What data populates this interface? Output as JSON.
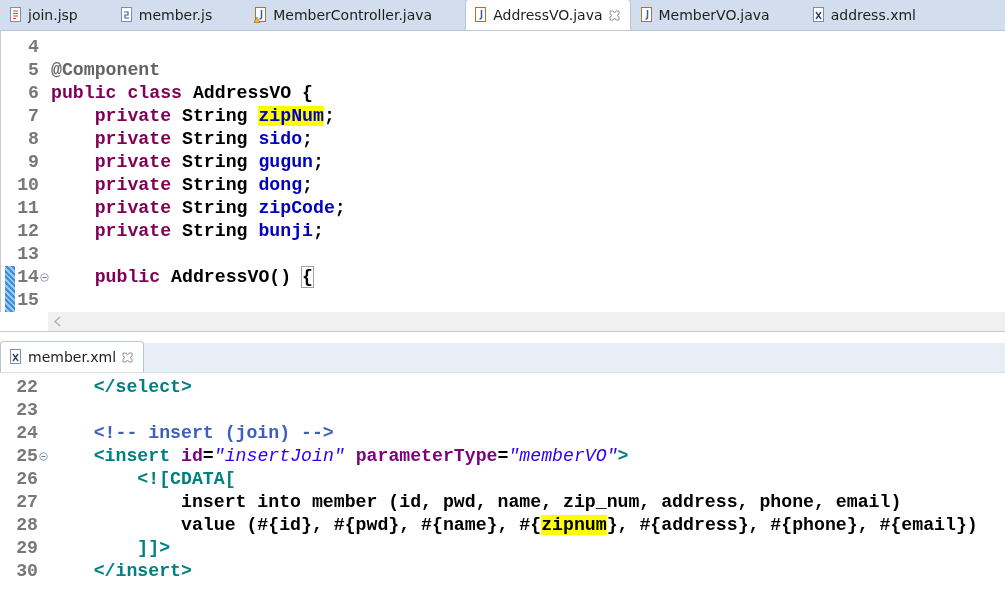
{
  "editor_tabs": [
    {
      "label": "join.jsp",
      "kind": "jsp",
      "selected": false
    },
    {
      "label": "member.js",
      "kind": "js",
      "selected": false
    },
    {
      "label": "MemberController.java",
      "kind": "java-warning",
      "selected": false
    },
    {
      "label": "AddressVO.java",
      "kind": "java",
      "selected": true
    },
    {
      "label": "MemberVO.java",
      "kind": "java",
      "selected": false
    },
    {
      "label": "address.xml",
      "kind": "xml",
      "selected": false
    }
  ],
  "top_editor": {
    "lines": [
      {
        "number": "4"
      },
      {
        "number": "5",
        "tokens": [
          {
            "text": "@Component",
            "kind": "annotation"
          }
        ]
      },
      {
        "number": "6",
        "tokens": [
          {
            "text": "public class",
            "kind": "keyword"
          },
          {
            "text": " AddressVO {",
            "kind": "plain"
          }
        ]
      },
      {
        "number": "7",
        "tokens": [
          {
            "text": "    private",
            "kind": "keyword"
          },
          {
            "text": " String ",
            "kind": "plain"
          },
          {
            "text": "zipNum",
            "kind": "field",
            "highlighted": true
          },
          {
            "text": ";",
            "kind": "plain"
          }
        ]
      },
      {
        "number": "8",
        "tokens": [
          {
            "text": "    private",
            "kind": "keyword"
          },
          {
            "text": " String ",
            "kind": "plain"
          },
          {
            "text": "sido",
            "kind": "field"
          },
          {
            "text": ";",
            "kind": "plain"
          }
        ]
      },
      {
        "number": "9",
        "tokens": [
          {
            "text": "    private",
            "kind": "keyword"
          },
          {
            "text": " String ",
            "kind": "plain"
          },
          {
            "text": "gugun",
            "kind": "field"
          },
          {
            "text": ";",
            "kind": "plain"
          }
        ]
      },
      {
        "number": "10",
        "tokens": [
          {
            "text": "    private",
            "kind": "keyword"
          },
          {
            "text": " String ",
            "kind": "plain"
          },
          {
            "text": "dong",
            "kind": "field"
          },
          {
            "text": ";",
            "kind": "plain"
          }
        ]
      },
      {
        "number": "11",
        "tokens": [
          {
            "text": "    private",
            "kind": "keyword"
          },
          {
            "text": " String ",
            "kind": "plain"
          },
          {
            "text": "zipCode",
            "kind": "field"
          },
          {
            "text": ";",
            "kind": "plain"
          }
        ]
      },
      {
        "number": "12",
        "tokens": [
          {
            "text": "    private",
            "kind": "keyword"
          },
          {
            "text": " String ",
            "kind": "plain"
          },
          {
            "text": "bunji",
            "kind": "field"
          },
          {
            "text": ";",
            "kind": "plain"
          }
        ]
      },
      {
        "number": "13"
      },
      {
        "number": "14",
        "changed": true,
        "foldable": true,
        "tokens": [
          {
            "text": "    public",
            "kind": "keyword"
          },
          {
            "text": " AddressVO() ",
            "kind": "plain"
          },
          {
            "text": "{",
            "kind": "plain",
            "bracket_match": true
          }
        ]
      },
      {
        "number": "15",
        "changed": true
      }
    ]
  },
  "bottom_tabs": [
    {
      "label": "member.xml",
      "kind": "xml",
      "selected": true
    }
  ],
  "bottom_editor": {
    "lines": [
      {
        "number": "22",
        "tokens": [
          {
            "text": "    </select>",
            "kind": "tag"
          }
        ]
      },
      {
        "number": "23"
      },
      {
        "number": "24",
        "tokens": [
          {
            "text": "    <!-- insert (join) -->",
            "kind": "comment"
          }
        ]
      },
      {
        "number": "25",
        "foldable": true,
        "tokens": [
          {
            "text": "    <insert",
            "kind": "tag"
          },
          {
            "text": " id",
            "kind": "attr"
          },
          {
            "text": "=",
            "kind": "plain"
          },
          {
            "text": "\"insertJoin\"",
            "kind": "value"
          },
          {
            "text": " parameterType",
            "kind": "attr"
          },
          {
            "text": "=",
            "kind": "plain"
          },
          {
            "text": "\"memberVO\"",
            "kind": "value"
          },
          {
            "text": ">",
            "kind": "tag"
          }
        ]
      },
      {
        "number": "26",
        "tokens": [
          {
            "text": "        <![CDATA[",
            "kind": "tag"
          }
        ]
      },
      {
        "number": "27",
        "tokens": [
          {
            "text": "            insert into member (id, pwd, name, zip_num, address, phone, email)",
            "kind": "plain"
          }
        ]
      },
      {
        "number": "28",
        "tokens": [
          {
            "text": "            value (#{id}, #{pwd}, #{name}, #{",
            "kind": "plain"
          },
          {
            "text": "zipnum",
            "kind": "plain",
            "highlighted": true
          },
          {
            "text": "}, #{address}, #{phone}, #{email})",
            "kind": "plain"
          }
        ]
      },
      {
        "number": "29",
        "tokens": [
          {
            "text": "        ]]>",
            "kind": "tag"
          }
        ]
      },
      {
        "number": "30",
        "tokens": [
          {
            "text": "    </insert>",
            "kind": "tag"
          }
        ]
      }
    ]
  }
}
